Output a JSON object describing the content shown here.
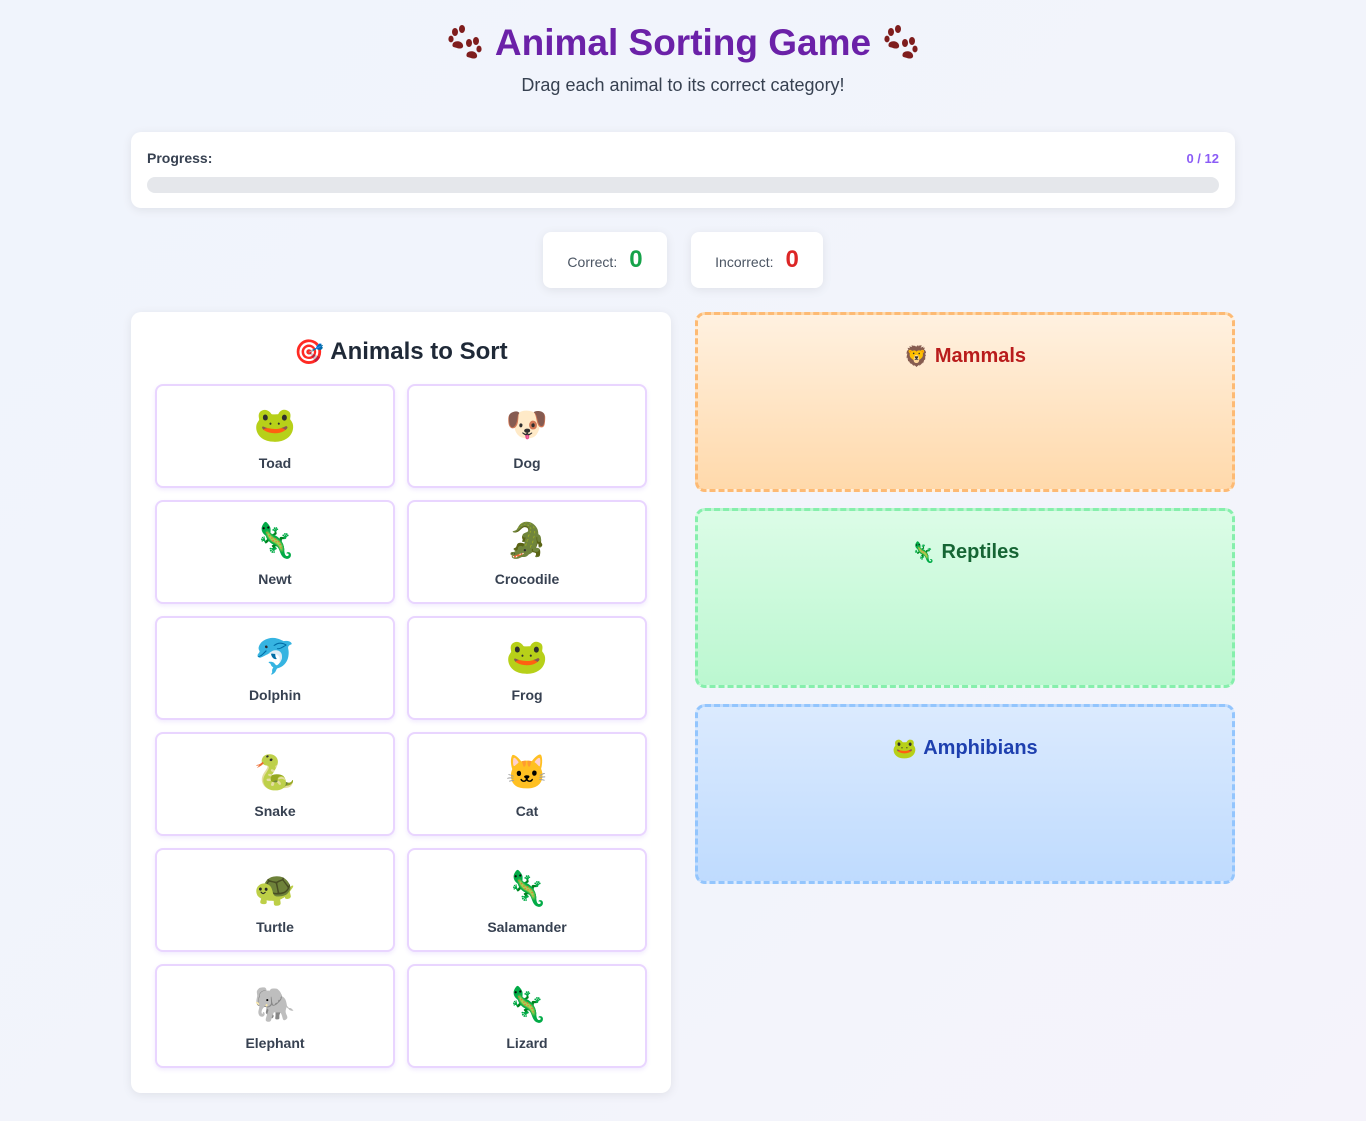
{
  "header": {
    "title": "Animal Sorting Game",
    "subtitle": "Drag each animal to its correct category!",
    "icon": "paw-prints-icon"
  },
  "progress": {
    "label": "Progress:",
    "count_text": "0 / 12",
    "fraction": 0
  },
  "scores": {
    "correct_label": "Correct:",
    "correct_value": "0",
    "incorrect_label": "Incorrect:",
    "incorrect_value": "0"
  },
  "animals_panel": {
    "icon": "🎯",
    "title": "Animals to Sort",
    "animals": [
      {
        "name": "Toad",
        "emoji": "🐸"
      },
      {
        "name": "Dog",
        "emoji": "🐶"
      },
      {
        "name": "Newt",
        "emoji": "🦎"
      },
      {
        "name": "Crocodile",
        "emoji": "🐊"
      },
      {
        "name": "Dolphin",
        "emoji": "🐬"
      },
      {
        "name": "Frog",
        "emoji": "🐸"
      },
      {
        "name": "Snake",
        "emoji": "🐍"
      },
      {
        "name": "Cat",
        "emoji": "🐱"
      },
      {
        "name": "Turtle",
        "emoji": "🐢"
      },
      {
        "name": "Salamander",
        "emoji": "🦎"
      },
      {
        "name": "Elephant",
        "emoji": "🐘"
      },
      {
        "name": "Lizard",
        "emoji": "🦎"
      }
    ]
  },
  "categories": [
    {
      "title": "Mammals",
      "emoji": "🦁",
      "color": "#b91c1c"
    },
    {
      "title": "Reptiles",
      "emoji": "🦎",
      "color": "#166534"
    },
    {
      "title": "Amphibians",
      "emoji": "🐸",
      "color": "#1e40af"
    }
  ],
  "colors": {
    "title": "#6b21a8",
    "accent": "#8b5cf6",
    "correct": "#16a34a",
    "incorrect": "#dc2626"
  }
}
